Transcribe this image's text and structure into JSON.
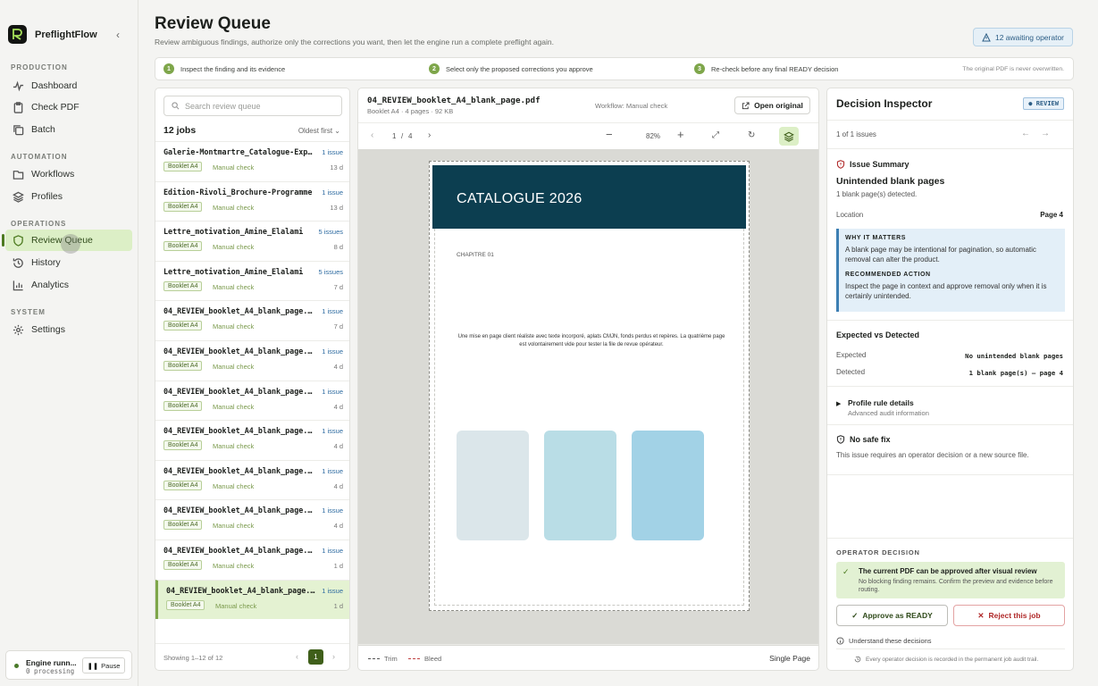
{
  "app": {
    "name": "PreflightFlow"
  },
  "sidebar": {
    "sections": [
      {
        "label": "PRODUCTION",
        "items": [
          "Dashboard",
          "Check PDF",
          "Batch"
        ]
      },
      {
        "label": "AUTOMATION",
        "items": [
          "Workflows",
          "Profiles"
        ]
      },
      {
        "label": "OPERATIONS",
        "items": [
          "Review Queue",
          "History",
          "Analytics"
        ]
      },
      {
        "label": "SYSTEM",
        "items": [
          "Settings"
        ]
      }
    ],
    "active_item": "Review Queue",
    "engine": {
      "status": "Engine runn...",
      "processing": "0 processing",
      "pause_label": "Pause"
    }
  },
  "header": {
    "title": "Review Queue",
    "subtitle": "Review ambiguous findings, authorize only the corrections you want, then let the engine run a complete preflight again.",
    "awaiting": "12 awaiting operator"
  },
  "steps": [
    {
      "n": "1",
      "label": "Inspect the finding and its evidence"
    },
    {
      "n": "2",
      "label": "Select only the proposed corrections you approve"
    },
    {
      "n": "3",
      "label": "Re-check before any final READY decision"
    }
  ],
  "steps_note": "The original PDF is never overwritten.",
  "queue": {
    "search_placeholder": "Search review queue",
    "count": "12 jobs",
    "sort": "Oldest first",
    "items": [
      {
        "name": "Galerie-Montmartre_Catalogue-Exposition",
        "issues": "1 issue",
        "badge": "Booklet A4",
        "check": "Manual check",
        "age": "13 d"
      },
      {
        "name": "Edition-Rivoli_Brochure-Programme",
        "issues": "1 issue",
        "badge": "Booklet A4",
        "check": "Manual check",
        "age": "13 d"
      },
      {
        "name": "Lettre_motivation_Amine_Elalami",
        "issues": "5 issues",
        "badge": "Booklet A4",
        "check": "Manual check",
        "age": "8 d"
      },
      {
        "name": "Lettre_motivation_Amine_Elalami",
        "issues": "5 issues",
        "badge": "Booklet A4",
        "check": "Manual check",
        "age": "7 d"
      },
      {
        "name": "04_REVIEW_booklet_A4_blank_page.pdf",
        "issues": "1 issue",
        "badge": "Booklet A4",
        "check": "Manual check",
        "age": "7 d"
      },
      {
        "name": "04_REVIEW_booklet_A4_blank_page.pdf",
        "issues": "1 issue",
        "badge": "Booklet A4",
        "check": "Manual check",
        "age": "4 d"
      },
      {
        "name": "04_REVIEW_booklet_A4_blank_page.pdf",
        "issues": "1 issue",
        "badge": "Booklet A4",
        "check": "Manual check",
        "age": "4 d"
      },
      {
        "name": "04_REVIEW_booklet_A4_blank_page.pdf",
        "issues": "1 issue",
        "badge": "Booklet A4",
        "check": "Manual check",
        "age": "4 d"
      },
      {
        "name": "04_REVIEW_booklet_A4_blank_page.pdf",
        "issues": "1 issue",
        "badge": "Booklet A4",
        "check": "Manual check",
        "age": "4 d"
      },
      {
        "name": "04_REVIEW_booklet_A4_blank_page.pdf",
        "issues": "1 issue",
        "badge": "Booklet A4",
        "check": "Manual check",
        "age": "4 d"
      },
      {
        "name": "04_REVIEW_booklet_A4_blank_page.pdf",
        "issues": "1 issue",
        "badge": "Booklet A4",
        "check": "Manual check",
        "age": "1 d"
      },
      {
        "name": "04_REVIEW_booklet_A4_blank_page.pdf",
        "issues": "1 issue",
        "badge": "Booklet A4",
        "check": "Manual check",
        "age": "1 d"
      }
    ],
    "selected_index": 11,
    "footer": "Showing 1–12 of 12",
    "page": "1"
  },
  "viewer": {
    "filename": "04_REVIEW_booklet_A4_blank_page.pdf",
    "meta": "Booklet A4 · 4 pages · 92 KB",
    "workflow": "Workflow: Manual check",
    "open_label": "Open original",
    "page_current": "1",
    "page_sep": "/",
    "page_total": "4",
    "zoom": "82%",
    "doc": {
      "cover_title": "CATALOGUE 2026",
      "chapter": "CHAPITRE 01",
      "body": "Une mise en page client réaliste avec texte incorporé, aplats CMJN, fonds perdus et repères. La quatrième page est volontairement vide pour tester la file de revue opérateur.",
      "cover_color": "#0c3e50",
      "swatches": [
        "#dbe6ea",
        "#b9dde6",
        "#a2d2e6"
      ]
    },
    "legend_trim": "Trim",
    "legend_bleed": "Bleed",
    "view_mode": "Single Page"
  },
  "inspector": {
    "title": "Decision Inspector",
    "status": "REVIEW",
    "position": "1 of 1 issues",
    "summary_heading": "Issue Summary",
    "issue_title": "Unintended blank pages",
    "issue_desc": "1 blank page(s) detected.",
    "location_label": "Location",
    "location_value": "Page 4",
    "why_heading": "WHY IT MATTERS",
    "why_text": "A blank page may be intentional for pagination, so automatic removal can alter the product.",
    "action_heading": "RECOMMENDED ACTION",
    "action_text": "Inspect the page in context and approve removal only when it is certainly unintended.",
    "expected_heading": "Expected vs Detected",
    "expected_label": "Expected",
    "expected_value": "No unintended blank pages",
    "detected_label": "Detected",
    "detected_value": "1 blank page(s) — page 4",
    "rule_title": "Profile rule details",
    "rule_sub": "Advanced audit information",
    "nosafe_heading": "No safe fix",
    "nosafe_text": "This issue requires an operator decision or a new source file.",
    "operator_heading": "OPERATOR DECISION",
    "ok_title": "The current PDF can be approved after visual review",
    "ok_text": "No blocking finding remains. Confirm the preview and evidence before routing.",
    "approve_label": "Approve as READY",
    "reject_label": "Reject this job",
    "understand_label": "Understand these decisions",
    "audit_note": "Every operator decision is recorded in the permanent job audit trail."
  },
  "colors": {
    "accent": "#7ea64a",
    "active_bg": "#dcefc6",
    "info": "#3d7fb3",
    "danger": "#b02a2a"
  }
}
